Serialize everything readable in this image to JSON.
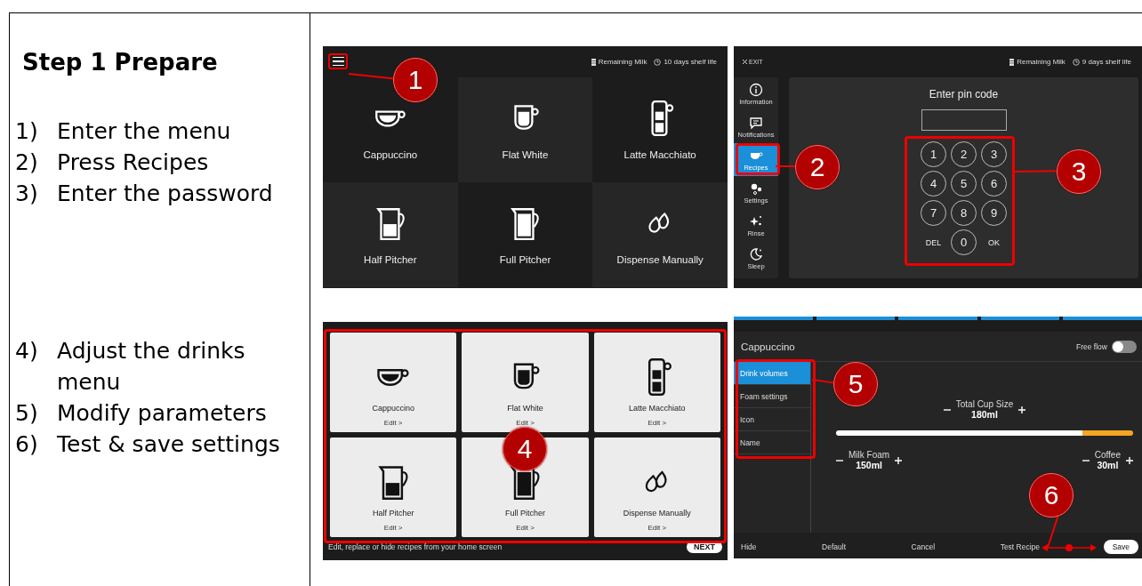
{
  "instructions": {
    "heading": "Step 1 Prepare",
    "groups": [
      [
        {
          "number": "1)",
          "text": "Enter the menu"
        },
        {
          "number": "2)",
          "text": "Press Recipes"
        },
        {
          "number": "3)",
          "text": "Enter the password"
        }
      ],
      [
        {
          "number": "4)",
          "text": "Adjust the drinks menu"
        },
        {
          "number": "5)",
          "text": "Modify parameters"
        },
        {
          "number": "6)",
          "text": "Test & save settings"
        }
      ]
    ]
  },
  "home_screen": {
    "milk_status": "Remaining Milk",
    "shelf_life": "10 days shelf life",
    "callout": "1",
    "tiles": [
      {
        "name": "Cappuccino"
      },
      {
        "name": "Flat White"
      },
      {
        "name": "Latte Macchiato"
      },
      {
        "name": "Half Pitcher"
      },
      {
        "name": "Full Pitcher"
      },
      {
        "name": "Dispense Manually"
      }
    ]
  },
  "pin_screen": {
    "exit": "EXIT",
    "milk_status": "Remaining Milk",
    "shelf_life": "9 days shelf life",
    "prompt": "Enter pin code",
    "callouts": [
      "2",
      "3"
    ],
    "menu": [
      {
        "label": "Information",
        "selected": false
      },
      {
        "label": "Notifications",
        "selected": false
      },
      {
        "label": "Recipes",
        "selected": true
      },
      {
        "label": "Settings",
        "selected": false
      },
      {
        "label": "Rinse",
        "selected": false
      },
      {
        "label": "Sleep",
        "selected": false
      }
    ],
    "keys": [
      {
        "label": "1",
        "kind": "digit"
      },
      {
        "label": "2",
        "kind": "digit"
      },
      {
        "label": "3",
        "kind": "digit"
      },
      {
        "label": "4",
        "kind": "digit"
      },
      {
        "label": "5",
        "kind": "digit"
      },
      {
        "label": "6",
        "kind": "digit"
      },
      {
        "label": "7",
        "kind": "digit"
      },
      {
        "label": "8",
        "kind": "digit"
      },
      {
        "label": "9",
        "kind": "digit"
      },
      {
        "label": "DEL",
        "kind": "text"
      },
      {
        "label": "0",
        "kind": "digit"
      },
      {
        "label": "OK",
        "kind": "text"
      }
    ]
  },
  "recipes_screen": {
    "hint": "Edit, replace or hide recipes from your home screen",
    "next": "NEXT",
    "callout": "4",
    "tiles": [
      {
        "name": "Cappuccino",
        "edit": "Edit >"
      },
      {
        "name": "Flat White",
        "edit": "Edit >"
      },
      {
        "name": "Latte Macchiato",
        "edit": "Edit >"
      },
      {
        "name": "Half Pitcher",
        "edit": "Edit >"
      },
      {
        "name": "Full Pitcher",
        "edit": "Edit >"
      },
      {
        "name": "Dispense Manually",
        "edit": "Edit >"
      }
    ]
  },
  "editor_screen": {
    "title": "Cappuccino",
    "free_flow": {
      "label": "Free flow",
      "on": false
    },
    "callouts": [
      "5",
      "6"
    ],
    "tabs": [
      {
        "label": "Drink volumes",
        "selected": true
      },
      {
        "label": "Foam settings",
        "selected": false
      },
      {
        "label": "Icon",
        "selected": false
      },
      {
        "label": "Name",
        "selected": false
      }
    ],
    "total": {
      "label": "Total Cup Size",
      "value": "180ml"
    },
    "mix": {
      "level": 0.83
    },
    "milk": {
      "label": "Milk Foam",
      "value": "150ml"
    },
    "coffee": {
      "label": "Coffee",
      "value": "30ml"
    },
    "actions": [
      {
        "label": "Hide",
        "kind": "text"
      },
      {
        "label": "Default",
        "kind": "text"
      },
      {
        "label": "Cancel",
        "kind": "text"
      },
      {
        "label": "Test Recipe",
        "kind": "text"
      },
      {
        "label": "Save",
        "kind": "pill"
      }
    ]
  }
}
